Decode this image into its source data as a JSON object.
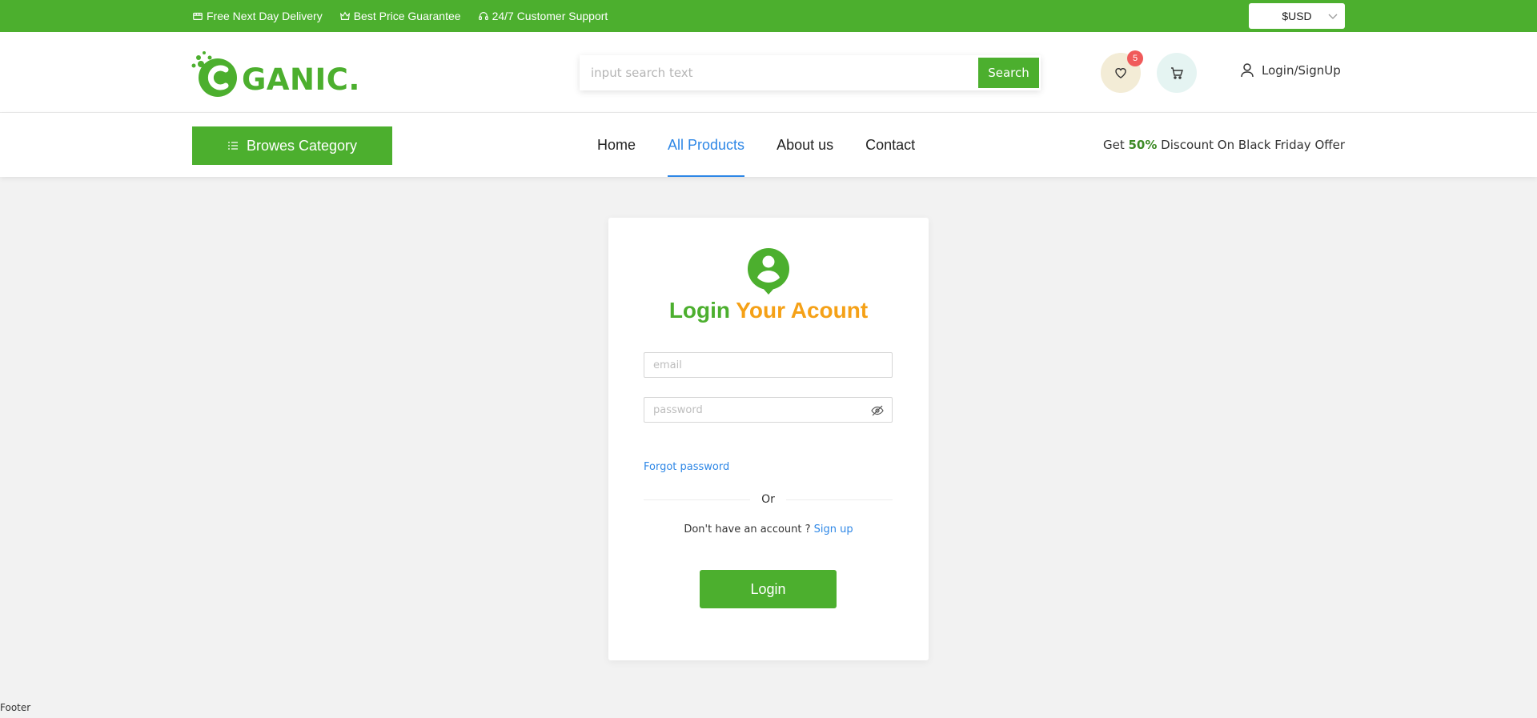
{
  "topbar": {
    "perks": [
      {
        "icon": "truck-icon",
        "label": "Free Next Day Delivery"
      },
      {
        "icon": "crown-icon",
        "label": "Best Price Guarantee"
      },
      {
        "icon": "headset-icon",
        "label": "24/7 Customer Support"
      }
    ],
    "currency": "$USD"
  },
  "header": {
    "logo_text": "GANIC.",
    "search_placeholder": "input search text",
    "search_button": "Search",
    "wishlist_count": "5",
    "login_label": "Login/SignUp"
  },
  "nav": {
    "browse_label": "Browes Category",
    "links": [
      "Home",
      "All Products",
      "About us",
      "Contact"
    ],
    "active": "All Products",
    "offer_prefix": "Get",
    "offer_highlight": "50%",
    "offer_suffix": "Discount On Black Friday Offer"
  },
  "login_card": {
    "title_part1": "Login",
    "title_part2": "Your Acount",
    "email_placeholder": "email",
    "password_placeholder": "password",
    "forgot": "Forgot password",
    "or": "Or",
    "no_account": "Don't have an account ?",
    "signup": "Sign up",
    "login_button": "Login"
  },
  "footer": "Footer",
  "colors": {
    "brand_green": "#4caf2e",
    "accent_orange": "#f5a117",
    "link_blue": "#2e87e6"
  }
}
